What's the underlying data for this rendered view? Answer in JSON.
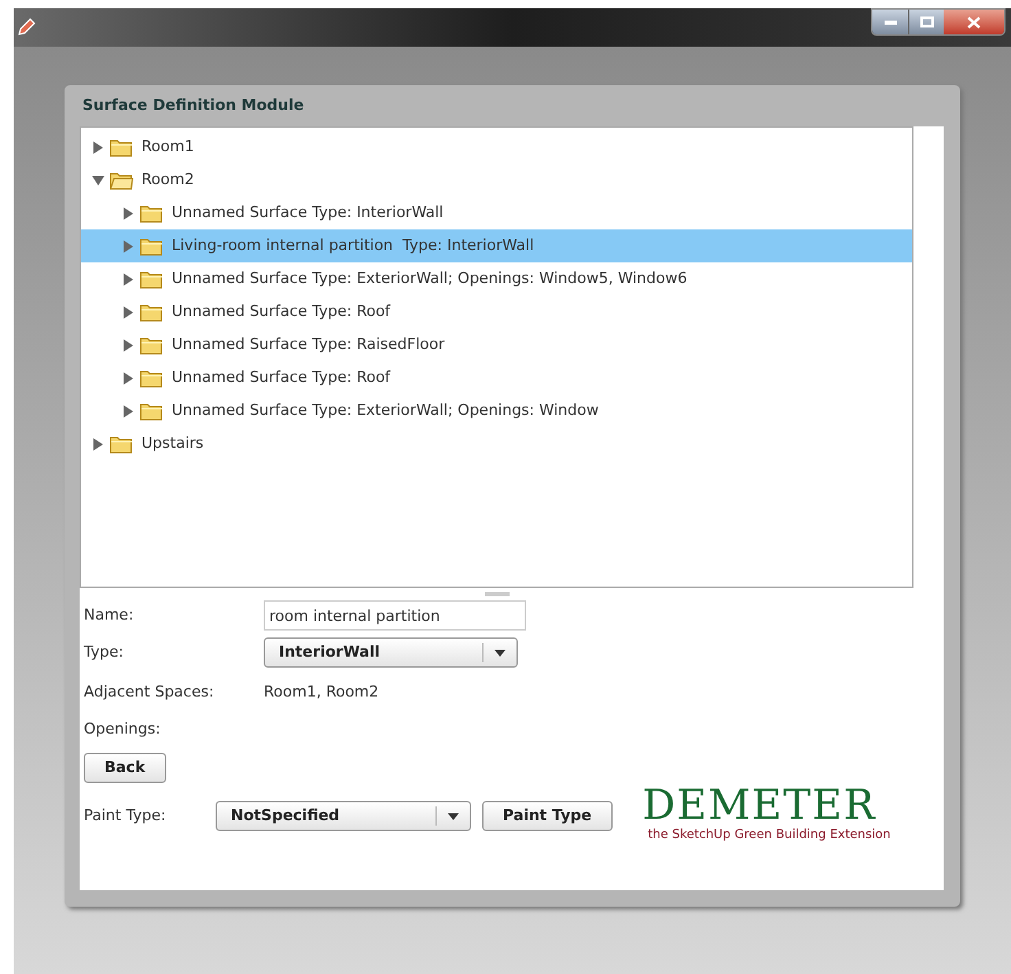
{
  "panel": {
    "title": "Surface Definition Module"
  },
  "tree": [
    {
      "label": "Room1",
      "expanded": false,
      "selected": false
    },
    {
      "label": "Room2",
      "expanded": true,
      "selected": false,
      "children": [
        {
          "label": "Unnamed Surface Type: InteriorWall",
          "expanded": false,
          "selected": false
        },
        {
          "label": "Living-room internal partition  Type: InteriorWall",
          "expanded": false,
          "selected": true
        },
        {
          "label": "Unnamed Surface Type: ExteriorWall; Openings: Window5, Window6",
          "expanded": false,
          "selected": false
        },
        {
          "label": "Unnamed Surface Type: Roof",
          "expanded": false,
          "selected": false
        },
        {
          "label": "Unnamed Surface Type: RaisedFloor",
          "expanded": false,
          "selected": false
        },
        {
          "label": "Unnamed Surface Type: Roof",
          "expanded": false,
          "selected": false
        },
        {
          "label": "Unnamed Surface Type: ExteriorWall; Openings: Window",
          "expanded": false,
          "selected": false
        }
      ]
    },
    {
      "label": "Upstairs",
      "expanded": false,
      "selected": false
    }
  ],
  "form": {
    "name_label": "Name:",
    "name_value": "room internal partition",
    "type_label": "Type:",
    "type_value": "InteriorWall",
    "adjacent_label": "Adjacent Spaces:",
    "adjacent_value": "Room1, Room2",
    "openings_label": "Openings:"
  },
  "back_button": "Back",
  "paint": {
    "label": "Paint Type:",
    "value": "NotSpecified",
    "button": "Paint Type"
  },
  "logo": {
    "title": "DEMETER",
    "tagline": "the SketchUp Green Building Extension"
  }
}
